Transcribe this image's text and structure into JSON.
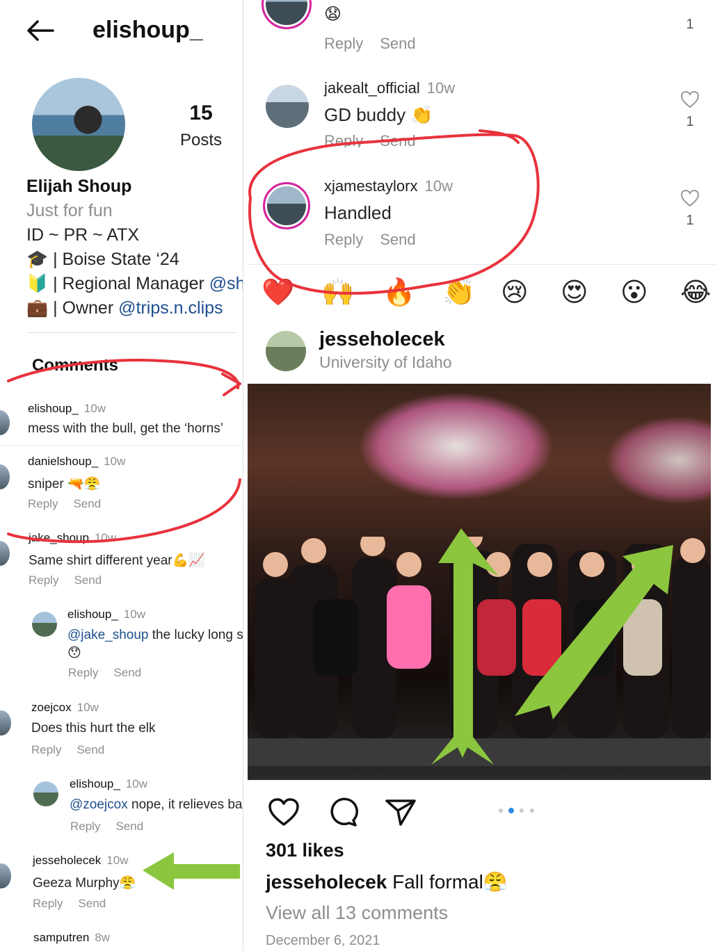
{
  "profile": {
    "handle": "elishoup_",
    "posts_count": "15",
    "posts_label": "Posts",
    "name": "Elijah Shoup",
    "category": "Just for fun",
    "bio_location": "ID ~ PR ~ ATX",
    "bio_school_icon": "🎓",
    "bio_school": " | Boise State ‘24",
    "bio_job_icon": "🔰",
    "bio_job_prefix": " | Regional Manager ",
    "bio_job_mention": "@sh",
    "bio_owner_icon": "💼",
    "bio_owner_prefix": " | Owner ",
    "bio_owner_mention": "@trips.n.clips"
  },
  "comments_title": "Comments",
  "left_comments": [
    {
      "user": "elishoup_",
      "time": "10w",
      "text": "mess with the bull, get the ‘horns’"
    },
    {
      "user": "danielshoup_",
      "time": "10w",
      "text": "sniper 🔫😤",
      "reply": "Reply",
      "send": "Send"
    },
    {
      "user": "jake_shoup",
      "time": "10w",
      "text": "Same shirt different year💪📈",
      "reply": "Reply",
      "send": "Send"
    },
    {
      "user": "elishoup_",
      "time": "10w",
      "mention": "@jake_shoup",
      "text": " the lucky long s",
      "emoji": "😯",
      "reply": "Reply",
      "send": "Send"
    },
    {
      "user": "zoejcox",
      "time": "10w",
      "text": "Does this hurt the elk",
      "reply": "Reply",
      "send": "Send"
    },
    {
      "user": "elishoup_",
      "time": "10w",
      "mention": "@zoejcox",
      "text": " nope, it relieves ba",
      "reply": "Reply",
      "send": "Send"
    },
    {
      "user": "jesseholecek",
      "time": "10w",
      "text": "Geeza Murphy😤",
      "reply": "Reply",
      "send": "Send"
    },
    {
      "user": "samputren",
      "time": "8w"
    }
  ],
  "right_comments": [
    {
      "text": "😧",
      "reply": "Reply",
      "send": "Send",
      "likes": "1"
    },
    {
      "user": "jakealt_official",
      "time": "10w",
      "text": "GD buddy 👏",
      "reply": "Reply",
      "send": "Send",
      "likes": "1"
    },
    {
      "user": "xjamestaylorx",
      "time": "10w",
      "text": "Handled",
      "reply": "Reply",
      "send": "Send",
      "likes": "1"
    }
  ],
  "emoji_bar": [
    "❤️",
    "🙌",
    "🔥",
    "👏",
    "😢",
    "😍",
    "😮",
    "😂"
  ],
  "post": {
    "user": "jesseholecek",
    "location": "University of Idaho",
    "likes": "301 likes",
    "caption_user": "jesseholecek",
    "caption_text": " Fall formal😤",
    "view_all": "View all 13 comments",
    "date": "December 6, 2021"
  },
  "icons": {
    "back": "back-arrow-icon",
    "like": "heart-icon",
    "comment": "comment-icon",
    "share": "send-icon"
  },
  "colors": {
    "annotation_red": "#e8323c",
    "annotation_green": "#8cc63f",
    "link_blue": "#1e4f8f",
    "story_ring": "#d6249f"
  }
}
